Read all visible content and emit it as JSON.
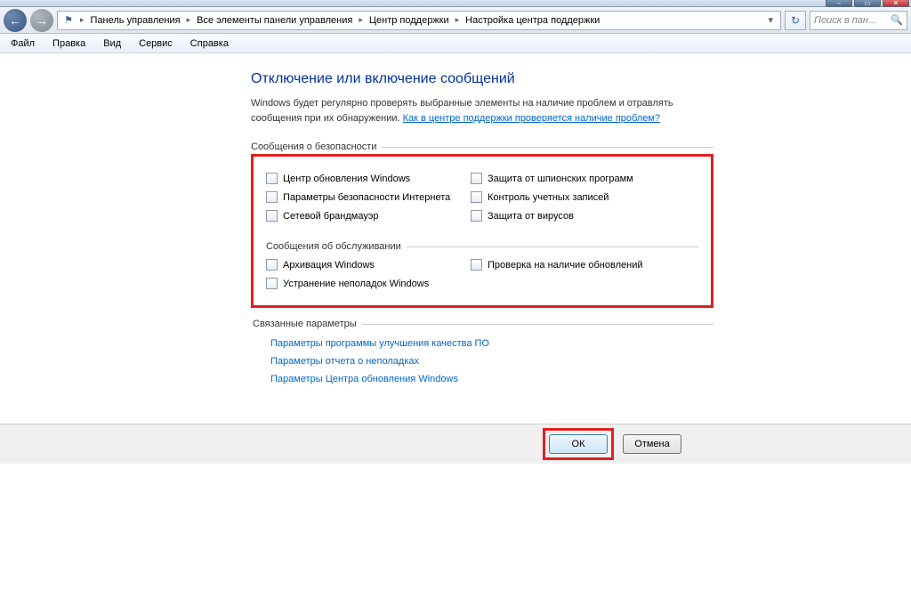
{
  "titlebar": {
    "min_icon": "–",
    "max_icon": "▭",
    "close_icon": "✕"
  },
  "nav": {
    "back_icon": "←",
    "forward_icon": "→",
    "refresh_icon": "↻",
    "dropdown_icon": "▾"
  },
  "breadcrumb": {
    "flag_icon": "⚑",
    "sep": "▸",
    "items": [
      "Панель управления",
      "Все элементы панели управления",
      "Центр поддержки",
      "Настройка центра поддержки"
    ]
  },
  "search": {
    "placeholder": "Поиск в пан...",
    "icon": "🔍"
  },
  "menu": {
    "items": [
      "Файл",
      "Правка",
      "Вид",
      "Сервис",
      "Справка"
    ]
  },
  "content": {
    "heading": "Отключение или включение сообщений",
    "desc_pre": "Windows будет регулярно проверять выбранные элементы на наличие проблем и отравлять сообщения при их обнаружении. ",
    "desc_link": "Как в центре поддержки проверяется наличие проблем?",
    "group_security": "Сообщения о безопасности",
    "security_left": [
      "Центр обновления Windows",
      "Параметры безопасности Интернета",
      "Сетевой брандмауэр"
    ],
    "security_right": [
      "Защита от шпионских программ",
      "Контроль учетных записей",
      "Защита от вирусов"
    ],
    "group_maintenance": "Сообщения об обслуживании",
    "maint_left": [
      "Архивация Windows",
      "Устранение неполадок Windows"
    ],
    "maint_right": [
      "Проверка на наличие обновлений"
    ],
    "group_related": "Связанные параметры",
    "related_links": [
      "Параметры программы улучшения качества ПО",
      "Параметры отчета о неполадках",
      "Параметры Центра обновления Windows"
    ]
  },
  "buttons": {
    "ok": "ОК",
    "cancel": "Отмена"
  }
}
